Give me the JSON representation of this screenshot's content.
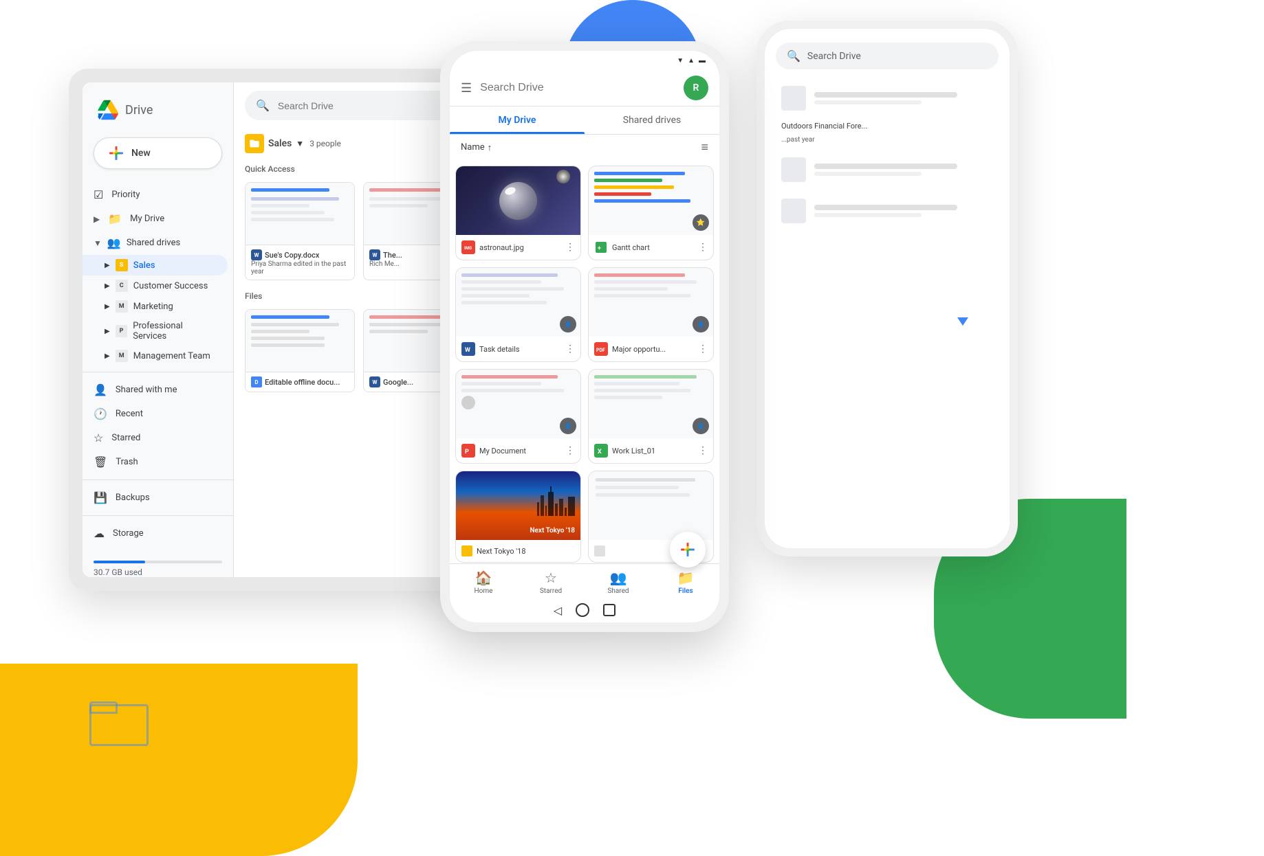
{
  "background": {
    "blue_circle": true,
    "yellow_shape": true,
    "green_shape": true
  },
  "laptop": {
    "sidebar": {
      "logo_text": "Drive",
      "new_button_label": "New",
      "items": [
        {
          "id": "priority",
          "label": "Priority",
          "icon": "check-circle"
        },
        {
          "id": "my-drive",
          "label": "My Drive",
          "icon": "folder"
        },
        {
          "id": "shared-drives",
          "label": "Shared drives",
          "icon": "people",
          "expanded": true
        },
        {
          "id": "shared-with-me",
          "label": "Shared with me",
          "icon": "people"
        },
        {
          "id": "recent",
          "label": "Recent",
          "icon": "clock"
        },
        {
          "id": "starred",
          "label": "Starred",
          "icon": "star"
        },
        {
          "id": "trash",
          "label": "Trash",
          "icon": "trash"
        },
        {
          "id": "backups",
          "label": "Backups",
          "icon": "backup"
        },
        {
          "id": "storage",
          "label": "Storage",
          "icon": "storage"
        }
      ],
      "shared_drives": [
        {
          "id": "sales",
          "label": "Sales",
          "selected": true
        },
        {
          "id": "customer-success",
          "label": "Customer Success"
        },
        {
          "id": "marketing",
          "label": "Marketing"
        },
        {
          "id": "professional-services",
          "label": "Professional Services"
        },
        {
          "id": "management-team",
          "label": "Management Team"
        }
      ],
      "storage_used": "30.7 GB used"
    },
    "main": {
      "search_placeholder": "Search Drive",
      "breadcrumb_folder": "Sales",
      "breadcrumb_people": "3 people",
      "quick_access_label": "Quick Access",
      "files_label": "Files",
      "quick_files": [
        {
          "name": "Sue's Copy.docx",
          "meta": "Priya Sharma edited in the past year",
          "icon": "word"
        },
        {
          "name": "The...",
          "meta": "Rich Me...",
          "icon": "word"
        }
      ],
      "files": [
        {
          "name": "Editable offline docu...",
          "icon": "docs"
        },
        {
          "name": "Google...",
          "icon": "word"
        }
      ]
    }
  },
  "phone_main": {
    "search_placeholder": "Search Drive",
    "avatar_initial": "R",
    "tabs": [
      {
        "label": "My Drive",
        "active": true
      },
      {
        "label": "Shared drives",
        "active": false
      }
    ],
    "sort_label": "Name",
    "sort_direction": "↑",
    "files": [
      {
        "id": "astronaut",
        "name": "astronaut.jpg",
        "type": "jpg",
        "has_badge": false
      },
      {
        "id": "gantt",
        "name": "Gantt chart",
        "type": "gantt",
        "has_badge": true
      },
      {
        "id": "task",
        "name": "Task details",
        "type": "word",
        "has_badge": true
      },
      {
        "id": "major",
        "name": "Major opportu...",
        "type": "pdf",
        "has_badge": true
      },
      {
        "id": "mydoc",
        "name": "My Document",
        "type": "slides",
        "has_badge": true
      },
      {
        "id": "worklist",
        "name": "Work List_01",
        "type": "sheets",
        "has_badge": true
      },
      {
        "id": "tokyo",
        "name": "Next Tokyo '18",
        "type": "image",
        "has_badge": false
      }
    ],
    "bottom_nav": [
      {
        "icon": "home",
        "label": "Home"
      },
      {
        "icon": "star",
        "label": "Starred"
      },
      {
        "icon": "people",
        "label": "Shared"
      },
      {
        "icon": "folder",
        "label": "Files",
        "active": true
      }
    ]
  },
  "phone_bg": {
    "search_placeholder": "Search Drive",
    "items": [
      {
        "name": "Outdoors Financial Fore...",
        "meta": "...past year"
      },
      {
        "name": "",
        "meta": ""
      },
      {
        "name": "",
        "meta": ""
      }
    ]
  }
}
